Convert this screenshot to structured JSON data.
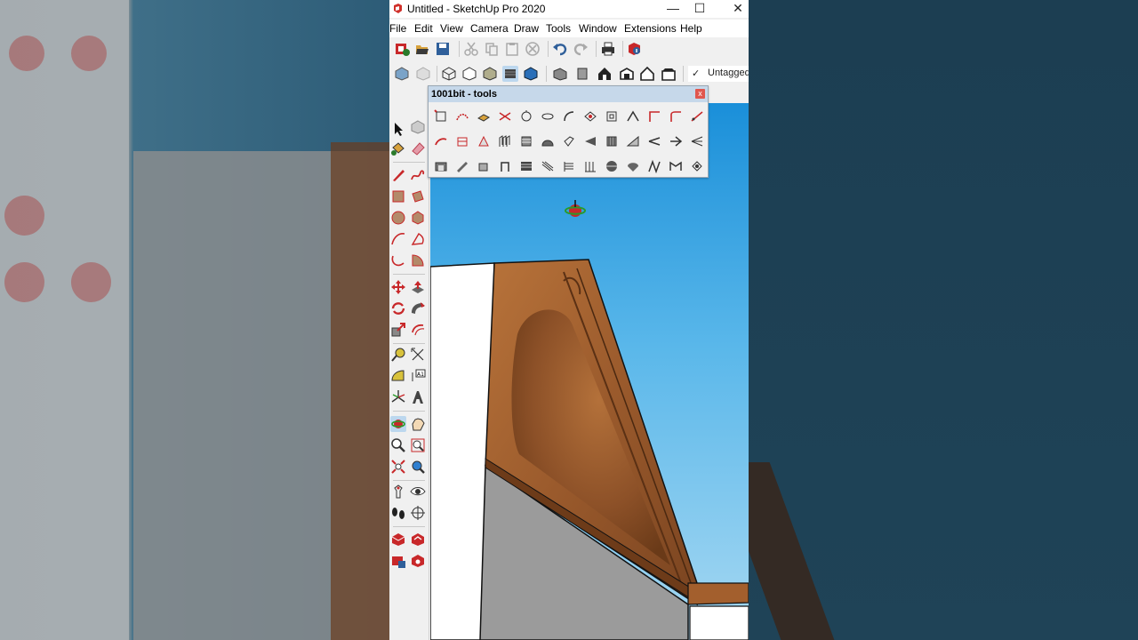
{
  "window": {
    "title": "Untitled - SketchUp Pro 2020",
    "minimize_glyph": "—",
    "maximize_glyph": "☐",
    "close_glyph": "✕"
  },
  "menu": [
    "File",
    "Edit",
    "View",
    "Camera",
    "Draw",
    "Tools",
    "Window",
    "Extensions",
    "Help"
  ],
  "tags": {
    "check": "✓",
    "label": "Untagged"
  },
  "floating_toolbar": {
    "title": "1001bit - tools",
    "close_glyph": "x"
  },
  "colors": {
    "sky_top": "#1a8fd9",
    "sky_bottom": "#a6d8f2",
    "wood": "#9a5a2c",
    "wall": "#ffffff",
    "accent_red": "#c8282a"
  }
}
